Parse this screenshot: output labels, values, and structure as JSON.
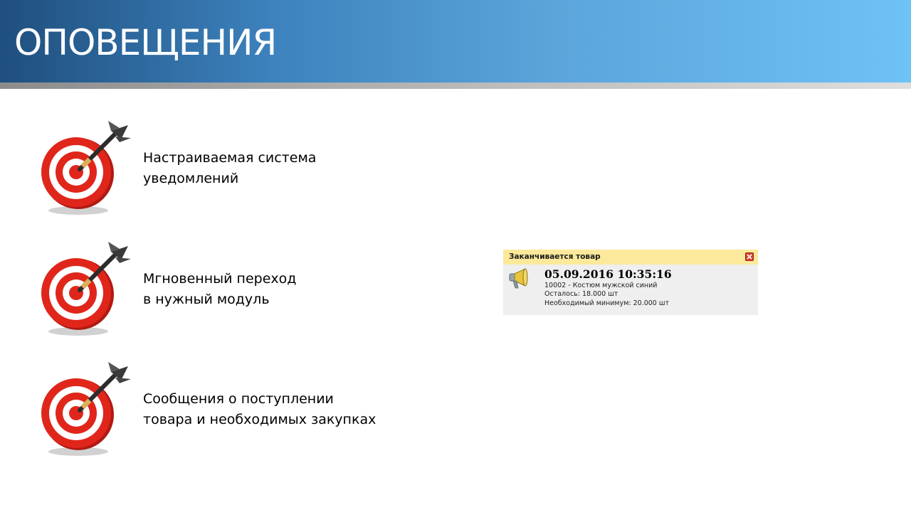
{
  "header": {
    "title": "ОПОВЕЩЕНИЯ"
  },
  "features": [
    {
      "icon": "target-dart-icon",
      "line1": "Настраиваемая система",
      "line2": "уведомлений"
    },
    {
      "icon": "target-dart-icon",
      "line1": "Мгновенный переход",
      "line2": "в нужный модуль"
    },
    {
      "icon": "target-dart-icon",
      "line1": "Сообщения о поступлении",
      "line2": "товара и необходимых закупках"
    }
  ],
  "notification": {
    "title": "Заканчивается товар",
    "icon": "megaphone-icon",
    "close_icon": "close-icon",
    "datetime": "05.09.2016 10:35:16",
    "item": "10002 - Костюм мужской синий",
    "remaining": "Осталось: 18.000 шт",
    "minimum": "Необходимый минимум: 20.000 шт"
  },
  "colors": {
    "header_gradient_start": "#1f4f7e",
    "header_gradient_end": "#6fc2f6",
    "popup_titlebar": "#fde99b",
    "popup_body": "#efefef",
    "target_red": "#e0261b"
  }
}
